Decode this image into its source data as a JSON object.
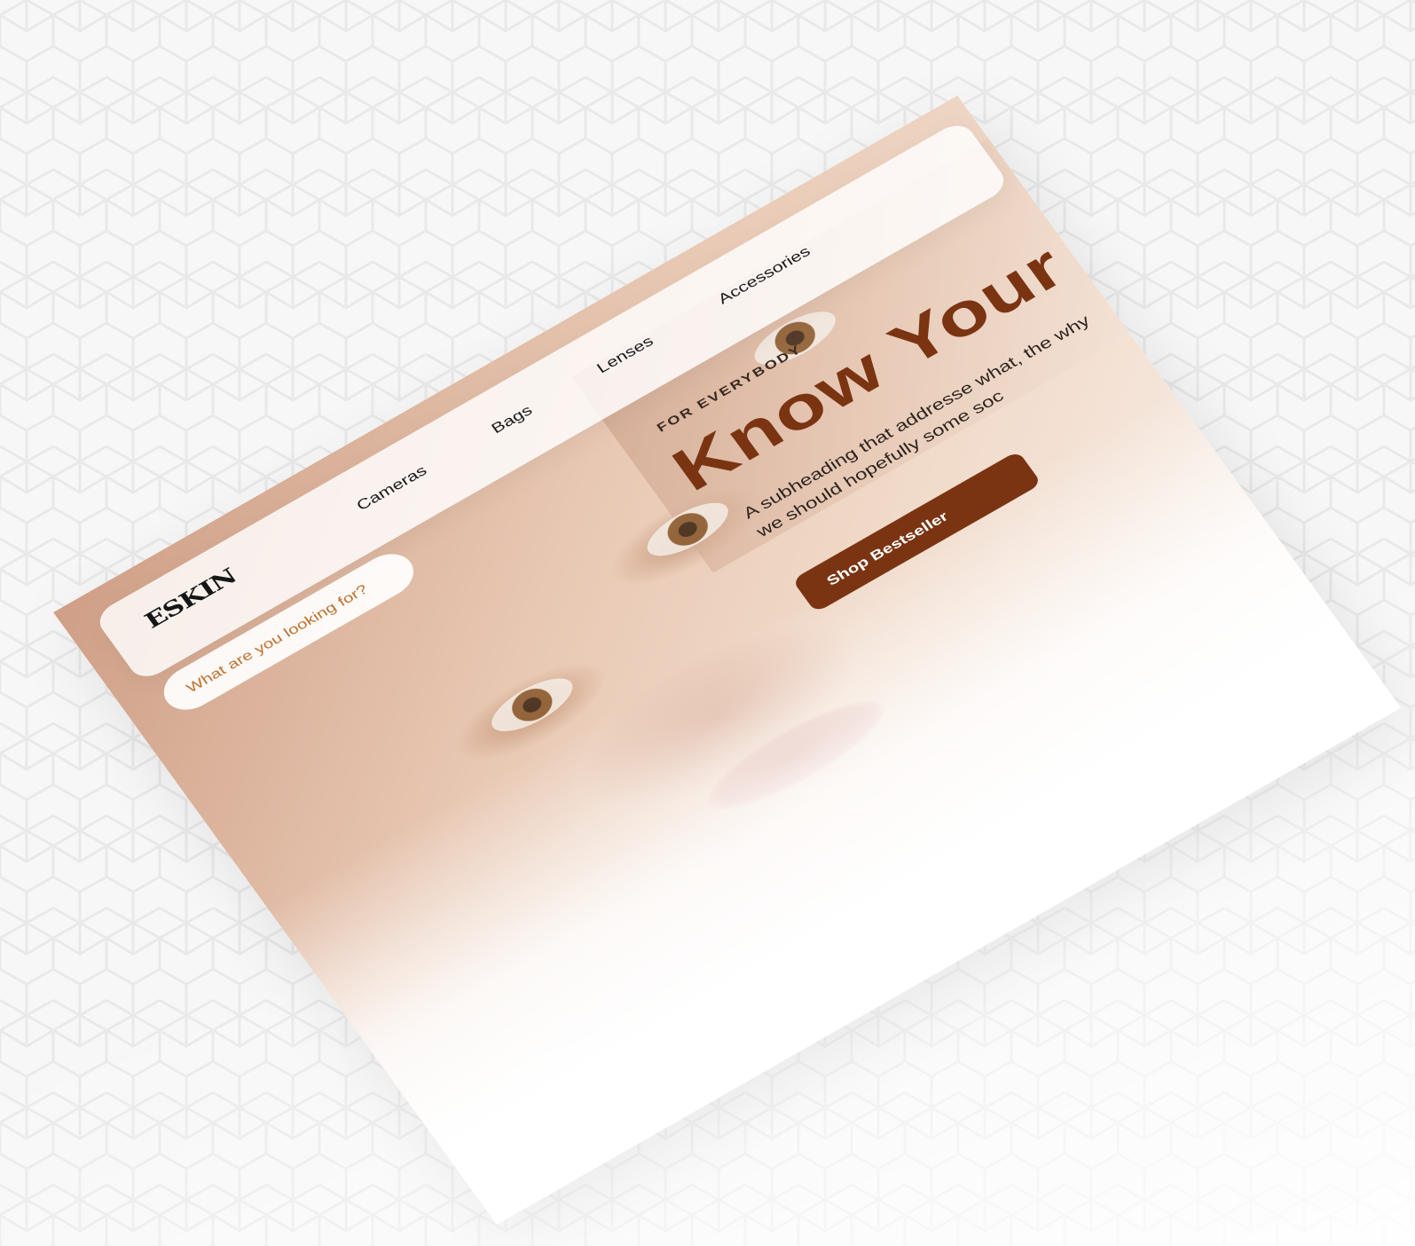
{
  "brand": {
    "logo_text": "ESKIN"
  },
  "search": {
    "placeholder": "What are you looking for?"
  },
  "nav": {
    "items": [
      {
        "label": "Cameras"
      },
      {
        "label": "Bags"
      },
      {
        "label": "Lenses"
      },
      {
        "label": "Accessories"
      }
    ]
  },
  "hero": {
    "eyebrow": "FOR EVERYBODY",
    "headline": "Know Your Sk",
    "subheading": "A subheading that addresse what, the why we should hopefully some soc",
    "cta_label": "Shop Bestseller"
  },
  "colors": {
    "accent": "#7a3412",
    "search_text": "#c0712f",
    "background": "#f7f7f7"
  }
}
